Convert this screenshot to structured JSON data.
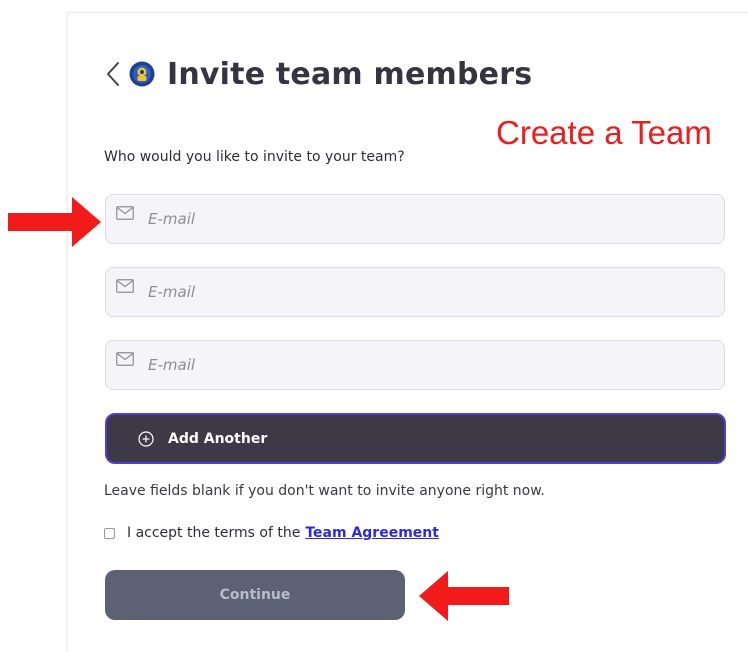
{
  "header": {
    "title": "Invite team members"
  },
  "annotation": {
    "label": "Create a Team"
  },
  "form": {
    "question": "Who would you like to invite to your team?",
    "email_fields": [
      {
        "placeholder": "E-mail",
        "value": ""
      },
      {
        "placeholder": "E-mail",
        "value": ""
      },
      {
        "placeholder": "E-mail",
        "value": ""
      }
    ],
    "add_another_label": "Add Another",
    "hint": "Leave fields blank if you don't want to invite anyone right now.",
    "terms_text": "I accept the terms of the",
    "terms_link": "Team Agreement",
    "terms_checked": false,
    "continue_label": "Continue"
  },
  "icons": {
    "back": "chevron-left-icon",
    "logo": "team-logo-icon",
    "mail": "mail-icon",
    "plus": "plus-circle-icon"
  },
  "colors": {
    "title": "#363440",
    "annotation": "#f21b1b",
    "add_another_bg": "#3d3946",
    "add_another_border": "#4f3fd6",
    "continue_bg": "#5c6274",
    "link": "#2b2bd9",
    "arrow": "#f21b1b"
  }
}
